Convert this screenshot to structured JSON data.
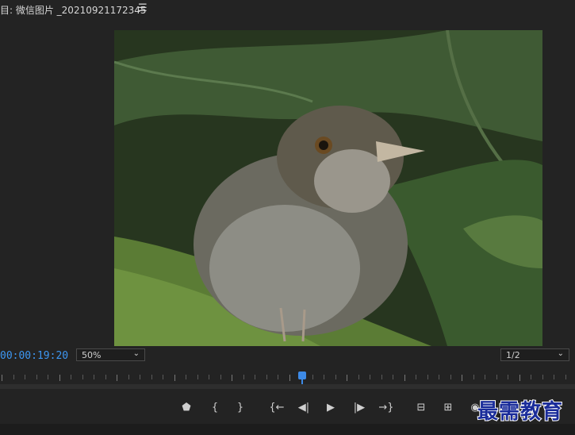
{
  "title_bar": {
    "title": "目: 微信图片 _20210921172345",
    "menu_icon": "☰"
  },
  "monitor": {
    "timecode": "00:00:19:20",
    "zoom": {
      "value": "50%"
    },
    "resolution": {
      "value": "1/2"
    },
    "playhead_position_fraction": 0.525,
    "accent_color": "#3d97f2"
  },
  "transport": {
    "buttons": [
      {
        "name": "add-marker-button",
        "icon": "marker-icon",
        "glyph": "⬟"
      },
      {
        "name": "mark-in-button",
        "icon": "mark-in-icon",
        "glyph": "{"
      },
      {
        "name": "mark-out-button",
        "icon": "mark-out-icon",
        "glyph": "}"
      },
      {
        "name": "go-to-in-button",
        "icon": "go-to-in-icon",
        "glyph": "{←"
      },
      {
        "name": "step-back-button",
        "icon": "step-back-icon",
        "glyph": "◀|"
      },
      {
        "name": "play-button",
        "icon": "play-icon",
        "glyph": "▶"
      },
      {
        "name": "step-forward-button",
        "icon": "step-forward-icon",
        "glyph": "|▶"
      },
      {
        "name": "go-to-out-button",
        "icon": "go-to-out-icon",
        "glyph": "→}"
      },
      {
        "name": "insert-button",
        "icon": "insert-icon",
        "glyph": "⊟"
      },
      {
        "name": "overwrite-button",
        "icon": "overwrite-icon",
        "glyph": "⊞"
      },
      {
        "name": "export-frame-button",
        "icon": "camera-icon",
        "glyph": "◉"
      }
    ]
  },
  "watermark": {
    "text": "最需教育"
  }
}
